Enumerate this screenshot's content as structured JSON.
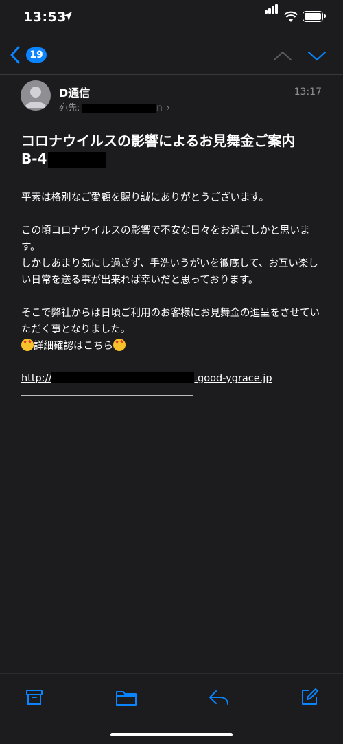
{
  "status": {
    "time": "13:53"
  },
  "nav": {
    "badge_count": "19"
  },
  "email": {
    "sender": "D通信",
    "to_label": "宛先:",
    "to_suffix": "n",
    "time": "13:17",
    "subject_line1": "コロナウイルスの影響によるお見舞金ご案内",
    "subject_line2_prefix": "B-4",
    "body": {
      "p1": "平素は格別なご愛顧を賜り誠にありがとうございます。",
      "p2a": "この頃コロナウイルスの影響で不安な日々をお過ごしかと思います。",
      "p2b": "しかしあまり気にし過ぎず、手洗いうがいを徹底して、お互い楽しい日常を送る事が出来れば幸いだと思っております。",
      "p3": "そこで弊社からは日頃ご利用のお客様にお見舞金の進呈をさせていただく事となりました。",
      "cta": "詳細確認はこちら",
      "link_prefix": "http://",
      "link_suffix": ".good-ygrace.jp"
    }
  },
  "icons": {
    "back": "chevron-left-icon",
    "up": "chevron-up-icon",
    "down": "chevron-down-icon",
    "archive": "archive-icon",
    "folder": "folder-icon",
    "reply": "reply-icon",
    "compose": "compose-icon"
  },
  "colors": {
    "accent": "#0a84ff",
    "background": "#1c1c1e",
    "secondary_text": "#8e8e93"
  }
}
